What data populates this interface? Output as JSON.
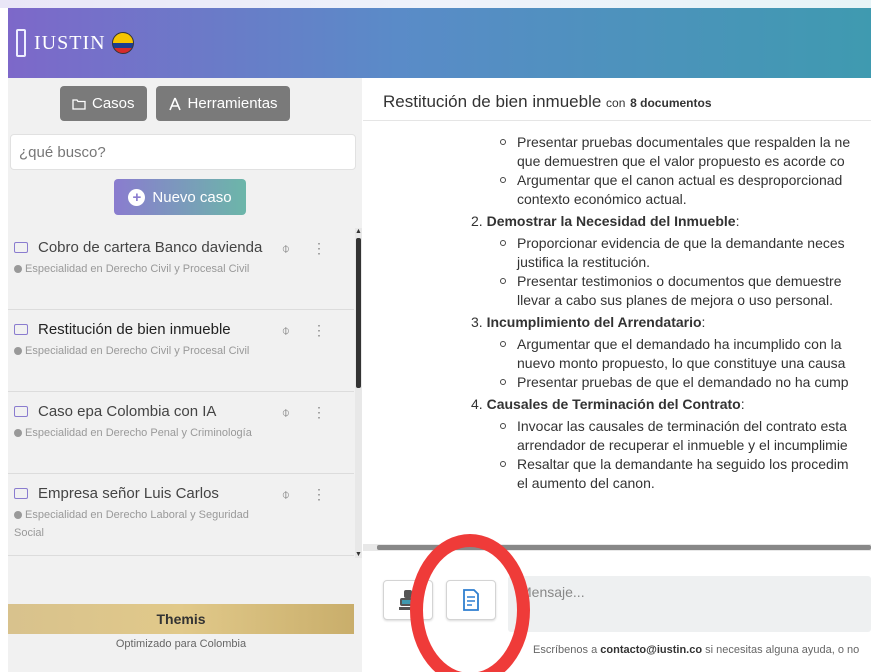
{
  "app": {
    "logo_text": "IUSTIN"
  },
  "sidebar": {
    "cases_button": "Casos",
    "tools_button": "Herramientas",
    "search_placeholder": "¿qué busco?",
    "new_case_button": "Nuevo caso",
    "cases": [
      {
        "title": "Cobro de cartera Banco davienda",
        "specialty": "Especialidad en Derecho Civil y Procesal Civil"
      },
      {
        "title": "Restitución de bien inmueble",
        "specialty": "Especialidad en Derecho Civil y Procesal Civil"
      },
      {
        "title": "Caso epa Colombia con IA",
        "specialty": "Especialidad en Derecho Penal y Criminología"
      },
      {
        "title": "Empresa señor Luis Carlos",
        "specialty": "Especialidad en Derecho Laboral y Seguridad Social"
      }
    ],
    "themis_label": "Themis",
    "optimized_label": "Optimizado para Colombia"
  },
  "chat": {
    "title": "Restitución de bien inmueble",
    "docs_prefix": "con",
    "docs_count": "8 documentos",
    "lines": {
      "l1": "Presentar pruebas documentales que respalden la ne",
      "l2": "que demuestren que el valor propuesto es acorde co",
      "l3": "Argumentar que el canon actual es desproporcionad",
      "l4": "contexto económico actual.",
      "h2_num": "2.",
      "h2": "Demostrar la Necesidad del Inmueble",
      "l5": "Proporcionar evidencia de que la demandante neces",
      "l6": "justifica la restitución.",
      "l7": "Presentar testimonios o documentos que demuestre",
      "l8": "llevar a cabo sus planes de mejora o uso personal.",
      "h3_num": "3.",
      "h3": "Incumplimiento del Arrendatario",
      "l9": "Argumentar que el demandado ha incumplido con la",
      "l10": "nuevo monto propuesto, lo que constituye una causa",
      "l11": "Presentar pruebas de que el demandado no ha cump",
      "h4_num": "4.",
      "h4": "Causales de Terminación del Contrato",
      "l12": "Invocar las causales de terminación del contrato esta",
      "l13": "arrendador de recuperar el inmueble y el incumplimie",
      "l14": "Resaltar que la demandante ha seguido los procedim",
      "l15": "el aumento del canon."
    },
    "message_placeholder": "Mensaje...",
    "footer_prefix": "Escríbenos a",
    "footer_email": "contacto@iustin.co",
    "footer_suffix": "si necesitas alguna ayuda, o no"
  },
  "colors": {
    "accent_purple": "#8a7ccf",
    "accent_teal": "#3f9ab0",
    "highlight_red": "#ef3b39",
    "themis_gold": "#d8c28d"
  }
}
